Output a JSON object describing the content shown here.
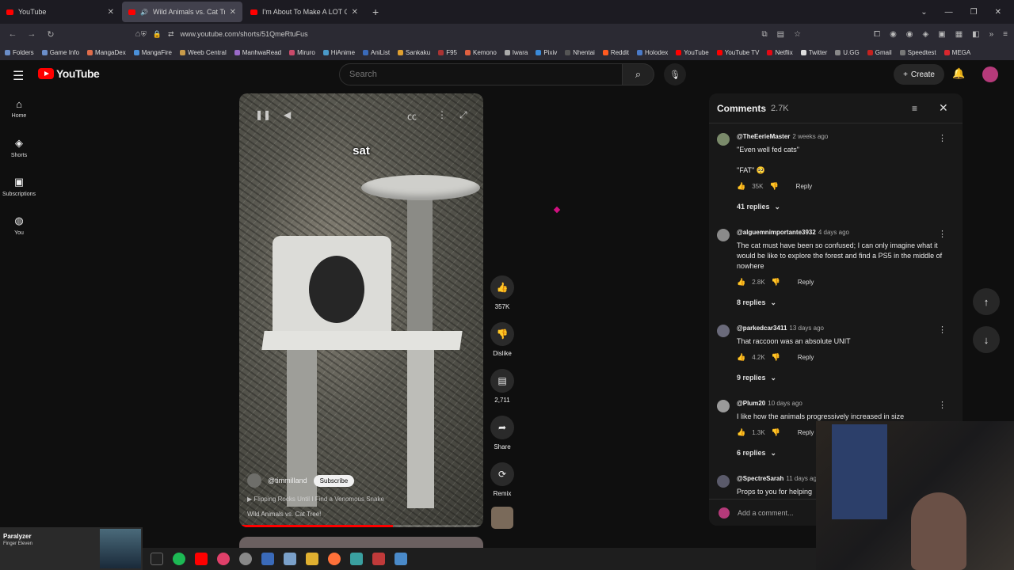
{
  "browser": {
    "tabs": [
      {
        "title": "YouTube",
        "active": false
      },
      {
        "title": "Wild Animals vs. Cat Tree!",
        "active": true
      },
      {
        "title": "I'm About To Make A LOT Of Pe",
        "active": false
      }
    ],
    "url": "www.youtube.com/shorts/51QmeRtuFus",
    "bookmarks": [
      "Folders",
      "Game Info",
      "MangaDex",
      "MangaFire",
      "Weeb Central",
      "ManhwaRead",
      "Miruro",
      "HiAnime",
      "AniList",
      "Sankaku",
      "F95",
      "Kemono",
      "Iwara",
      "Pixiv",
      "Nhentai",
      "Reddit",
      "Holodex",
      "YouTube",
      "YouTube TV",
      "Netflix",
      "Twitter",
      "U.GG",
      "Gmail",
      "Speedtest",
      "MEGA"
    ]
  },
  "header": {
    "logo_text": "YouTube",
    "search_placeholder": "Search",
    "create_label": "Create"
  },
  "leftnav": [
    {
      "label": "Home",
      "icon": "home-icon"
    },
    {
      "label": "Shorts",
      "icon": "shorts-icon"
    },
    {
      "label": "Subscriptions",
      "icon": "subscriptions-icon"
    },
    {
      "label": "You",
      "icon": "you-icon"
    }
  ],
  "video": {
    "caption": "sat",
    "channel": "@timmilland",
    "subscribe_label": "Subscribe",
    "related": "Flipping Rocks Until I Find a Venomous Snake",
    "title": "Wild Animals vs. Cat Tree!",
    "progress": 0.63
  },
  "actions": {
    "likes": "357K",
    "dislike_label": "Dislike",
    "comments": "2,711",
    "share_label": "Share",
    "remix_label": "Remix"
  },
  "comments": {
    "title": "Comments",
    "count": "2.7K",
    "add_placeholder": "Add a comment...",
    "items": [
      {
        "author": "@TheEerieMaster",
        "time": "2 weeks ago",
        "text": "\"Even well fed cats\"\n\n\"FAT\" 🥺",
        "likes": "35K",
        "reply": "Reply",
        "replies": "41 replies"
      },
      {
        "author": "@alguemnimportante3932",
        "time": "4 days ago",
        "text": "The cat must have been so confused; I can only imagine what it would be like to explore the forest and find a PS5 in the middle of nowhere",
        "likes": "2.8K",
        "reply": "Reply",
        "replies": "8 replies"
      },
      {
        "author": "@parkedcar3411",
        "time": "13 days ago",
        "text": "That raccoon was an absolute UNIT",
        "likes": "4.2K",
        "reply": "Reply",
        "replies": "9 replies"
      },
      {
        "author": "@Plum20",
        "time": "10 days ago",
        "text": "I like how the animals progressively increased in size",
        "likes": "1.3K",
        "reply": "Reply",
        "replies": "6 replies"
      },
      {
        "author": "@SpectreSarah",
        "time": "11 days ago",
        "text": "Props to you for helping",
        "likes": "",
        "reply": "",
        "replies": ""
      }
    ]
  },
  "nowplaying": {
    "song": "Paralyzer",
    "artist": "Finger Eleven"
  }
}
